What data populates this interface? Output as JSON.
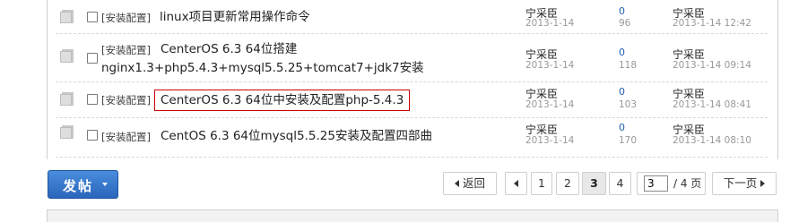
{
  "threads": [
    {
      "category": "[安装配置]",
      "title_lines": [
        "linux项目更新常用操作命令"
      ],
      "author": "宁采臣",
      "date": "2013-1-14",
      "replies": "0",
      "views": "96",
      "last_author": "宁采臣",
      "last_date": "2013-1-14 12:42"
    },
    {
      "category": "[安装配置]",
      "title_lines": [
        "CenterOS 6.3 64位搭建",
        "nginx1.3+php5.4.3+mysql5.5.25+tomcat7+jdk7安装"
      ],
      "author": "宁采臣",
      "date": "2013-1-14",
      "replies": "0",
      "views": "118",
      "last_author": "宁采臣",
      "last_date": "2013-1-14 09:14"
    },
    {
      "category": "[安装配置]",
      "title_lines": [
        "CenterOS 6.3 64位中安装及配置php-5.4.3"
      ],
      "author": "宁采臣",
      "date": "2013-1-14",
      "replies": "0",
      "views": "103",
      "last_author": "宁采臣",
      "last_date": "2013-1-14 08:41",
      "highlighted": true,
      "highlight_color": "#cc0000"
    },
    {
      "category": "[安装配置]",
      "title_lines": [
        "CentOS 6.3 64位mysql5.5.25安装及配置四部曲"
      ],
      "author": "宁采臣",
      "date": "2013-1-14",
      "replies": "0",
      "views": "170",
      "last_author": "宁采臣",
      "last_date": "2013-1-14 08:10"
    }
  ],
  "post_button": {
    "label": "发帖",
    "color": "#2a66bb"
  },
  "pagination": {
    "prev_label": "返回",
    "pages": [
      "1",
      "2",
      "3",
      "4"
    ],
    "current_page": "3",
    "page_input_value": "3",
    "total_label": "/ 4 页",
    "next_label": "下一页"
  },
  "icons": {
    "thread": "folder-icon",
    "prev": "prev-arrow-icon",
    "next": "next-arrow-icon",
    "dropdown": "caret-down-icon"
  }
}
